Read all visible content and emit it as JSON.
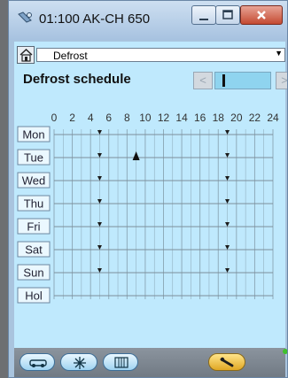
{
  "window": {
    "title": "01:100 AK-CH 650"
  },
  "dropdown": {
    "value": "Defrost"
  },
  "schedule": {
    "heading": "Defrost schedule",
    "hour_ticks": [
      "0",
      "2",
      "4",
      "6",
      "8",
      "10",
      "12",
      "14",
      "16",
      "18",
      "20",
      "22",
      "24"
    ],
    "days": [
      {
        "label": "Mon",
        "events": [
          5,
          19
        ]
      },
      {
        "label": "Tue",
        "events": [
          5,
          19
        ],
        "current_time": 9
      },
      {
        "label": "Wed",
        "events": [
          5,
          19
        ]
      },
      {
        "label": "Thu",
        "events": [
          5,
          19
        ]
      },
      {
        "label": "Fri",
        "events": [
          5,
          19
        ]
      },
      {
        "label": "Sat",
        "events": [
          5,
          19
        ]
      },
      {
        "label": "Sun",
        "events": [
          5,
          19
        ]
      },
      {
        "label": "Hol",
        "events": []
      }
    ]
  },
  "footer": {
    "buttons": [
      "car-icon",
      "snowflake-icon",
      "keypad-icon"
    ],
    "tools": "wrench-icon"
  },
  "colors": {
    "panel": "#bfe9fd",
    "grid": "#8aa5b4",
    "accent": "#8fd4ef"
  }
}
